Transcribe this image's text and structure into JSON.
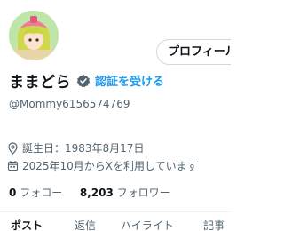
{
  "profile": {
    "display_name": "ままどら",
    "verify_link": "認証を受ける",
    "handle": "@Mommy6156574769",
    "profile_button": "プロフィール"
  },
  "meta": {
    "birthday": "誕生日：1983年8月17日",
    "joined": "2025年10月からXを利用しています"
  },
  "follow": {
    "following_count": "0",
    "following_label": "フォロー",
    "followers_count": "8,203",
    "followers_label": "フォロワー"
  },
  "tabs": [
    {
      "label": "ポスト"
    },
    {
      "label": "返信"
    },
    {
      "label": "ハイライト"
    },
    {
      "label": "記事"
    }
  ],
  "colors": {
    "accent": "#1d9bf0",
    "text": "#0f1419",
    "muted": "#536471",
    "border": "#cfd9de"
  }
}
